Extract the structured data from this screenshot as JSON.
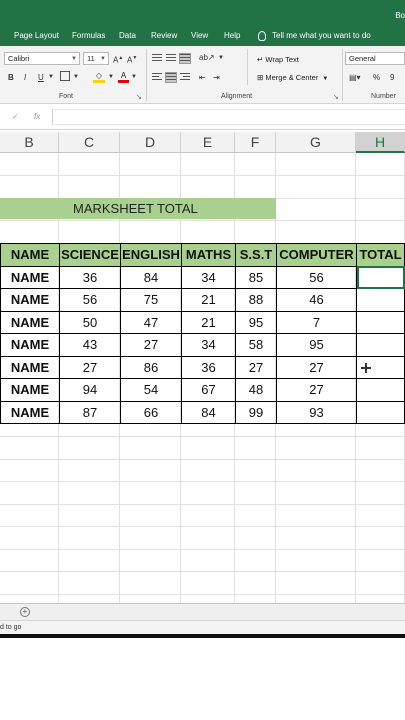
{
  "titlebar": {
    "right_text": "Bo"
  },
  "menu": {
    "items": [
      "Page Layout",
      "Formulas",
      "Data",
      "Review",
      "View",
      "Help"
    ],
    "tell_me": "Tell me what you want to do"
  },
  "ribbon": {
    "font_name": "Calibri",
    "font_size": "11",
    "number_format": "General",
    "bold": "B",
    "italic": "I",
    "underline": "U",
    "font_color_letter": "A",
    "wrap_text": "Wrap Text",
    "merge_center": "Merge & Center",
    "percent": "%",
    "comma": "9",
    "groups": {
      "font": "Font",
      "alignment": "Alignment",
      "number": "Number"
    }
  },
  "formula_bar": {
    "cancel": "✓",
    "fx": "fx",
    "value": ""
  },
  "columns": [
    "B",
    "C",
    "D",
    "E",
    "F",
    "G",
    "H"
  ],
  "active_column": "H",
  "sheet": {
    "banner": "MARKSHEET TOTAL",
    "headers": [
      "NAME",
      "SCIENCE",
      "ENGLISH",
      "MATHS",
      "S.S.T",
      "COMPUTER",
      "TOTAL"
    ],
    "rows": [
      [
        "NAME",
        "36",
        "84",
        "34",
        "85",
        "56",
        ""
      ],
      [
        "NAME",
        "56",
        "75",
        "21",
        "88",
        "46",
        ""
      ],
      [
        "NAME",
        "50",
        "47",
        "21",
        "95",
        "7",
        ""
      ],
      [
        "NAME",
        "43",
        "27",
        "34",
        "58",
        "95",
        ""
      ],
      [
        "NAME",
        "27",
        "86",
        "36",
        "27",
        "27",
        ""
      ],
      [
        "NAME",
        "94",
        "54",
        "67",
        "48",
        "27",
        ""
      ],
      [
        "NAME",
        "87",
        "66",
        "84",
        "99",
        "93",
        ""
      ]
    ]
  },
  "status": {
    "text": "d to go"
  },
  "colors": {
    "excel_green": "#217346",
    "header_fill": "#a9d08e"
  }
}
